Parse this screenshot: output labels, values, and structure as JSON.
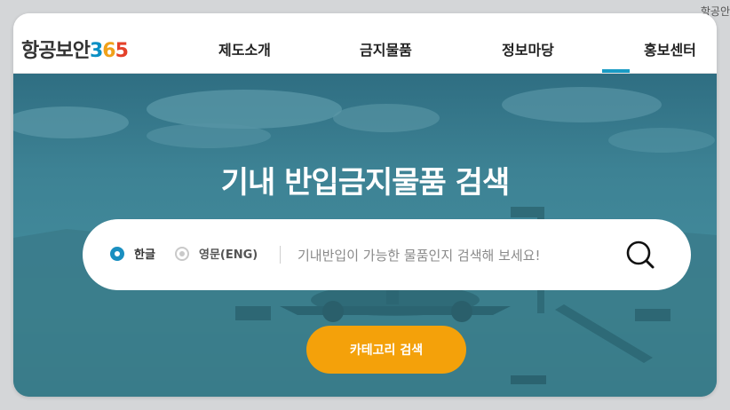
{
  "corner_text": "항공안",
  "logo": {
    "text": "항공보안",
    "n1": "3",
    "n2": "6",
    "n3": "5"
  },
  "nav": {
    "items": [
      {
        "label": "제도소개"
      },
      {
        "label": "금지물품"
      },
      {
        "label": "정보마당"
      },
      {
        "label": "홍보센터"
      }
    ],
    "active_index": 3
  },
  "hero": {
    "title": "기내 반입금지물품 검색"
  },
  "search": {
    "options": [
      {
        "label": "한글",
        "selected": true
      },
      {
        "label": "영문(ENG)",
        "selected": false
      }
    ],
    "placeholder": "기내반입이 가능한 물품인지 검색해 보세요!",
    "value": "",
    "button_icon": "search-icon"
  },
  "category_button": {
    "label": "카테고리 검색"
  },
  "colors": {
    "accent_blue": "#1a9bc4",
    "button_orange": "#f4a10a",
    "hero_overlay": "#3d8294"
  }
}
